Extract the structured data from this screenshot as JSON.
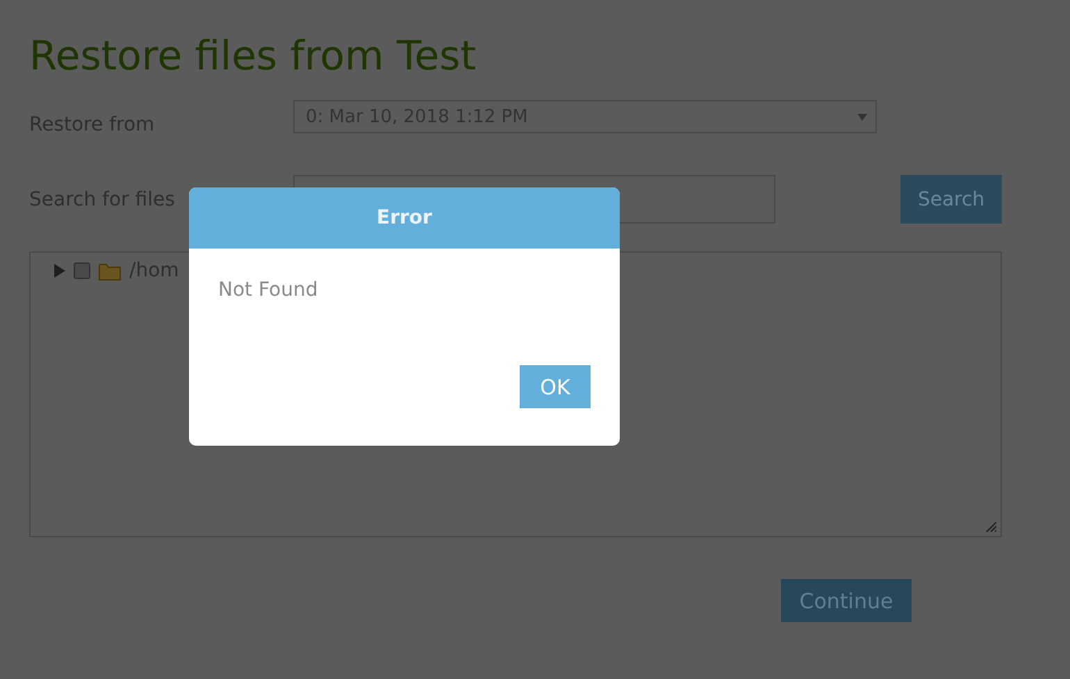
{
  "page": {
    "title": "Restore files from Test"
  },
  "restore_from": {
    "label": "Restore from",
    "value": "0: Mar 10, 2018 1:12 PM"
  },
  "search": {
    "label": "Search for files",
    "button": "Search"
  },
  "tree": {
    "items": [
      {
        "label": "/hom",
        "expanded": false,
        "checked": false
      }
    ]
  },
  "continue_button": "Continue",
  "dialog": {
    "title": "Error",
    "message": "Not Found",
    "button": "OK"
  }
}
